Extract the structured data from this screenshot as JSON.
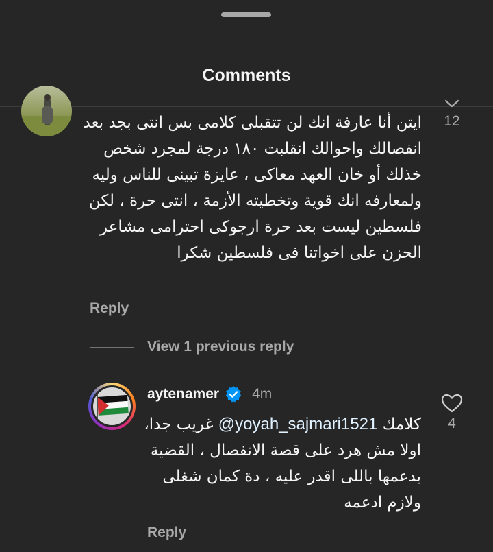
{
  "header": {
    "title": "Comments"
  },
  "comments": [
    {
      "text": "ايتن أنا عارفة انك لن تتقبلى كلامى بس انتى بجد بعد انفصالك واحوالك انقلبت ١٨٠ درجة لمجرد شخص خذلك أو خان العهد معاكى ، عايزة تبينى للناس وليه ولمعارفه انك قوية وتخطيته الأزمة ، انتى حرة ، لكن فلسطين ليست بعد حرة ارجوكى احترامى مشاعر الحزن على اخواتنا فى فلسطين شكرا",
      "like_count": "12",
      "reply_label": "Reply",
      "avatar_icon": "user-photo-avatar"
    }
  ],
  "view_replies": {
    "label": "View 1 previous reply"
  },
  "reply": {
    "username": "aytenamer",
    "verified_icon": "verified-badge-icon",
    "timestamp": "4m",
    "mention": "@yoyah_sajmari1521",
    "text": "كلامك غريب جدا، اولا مش هرد على قصة الانفصال ، القضية بدعمها باللى اقدر عليه ، دة كمان شغلى ولازم ادعمه",
    "like_count": "4",
    "reply_label": "Reply",
    "avatar_icon": "palestine-flag-avatar"
  },
  "colors": {
    "background": "#262626",
    "text": "#f5f5f5",
    "muted": "#a8a8a8",
    "verified": "#0095f6"
  }
}
